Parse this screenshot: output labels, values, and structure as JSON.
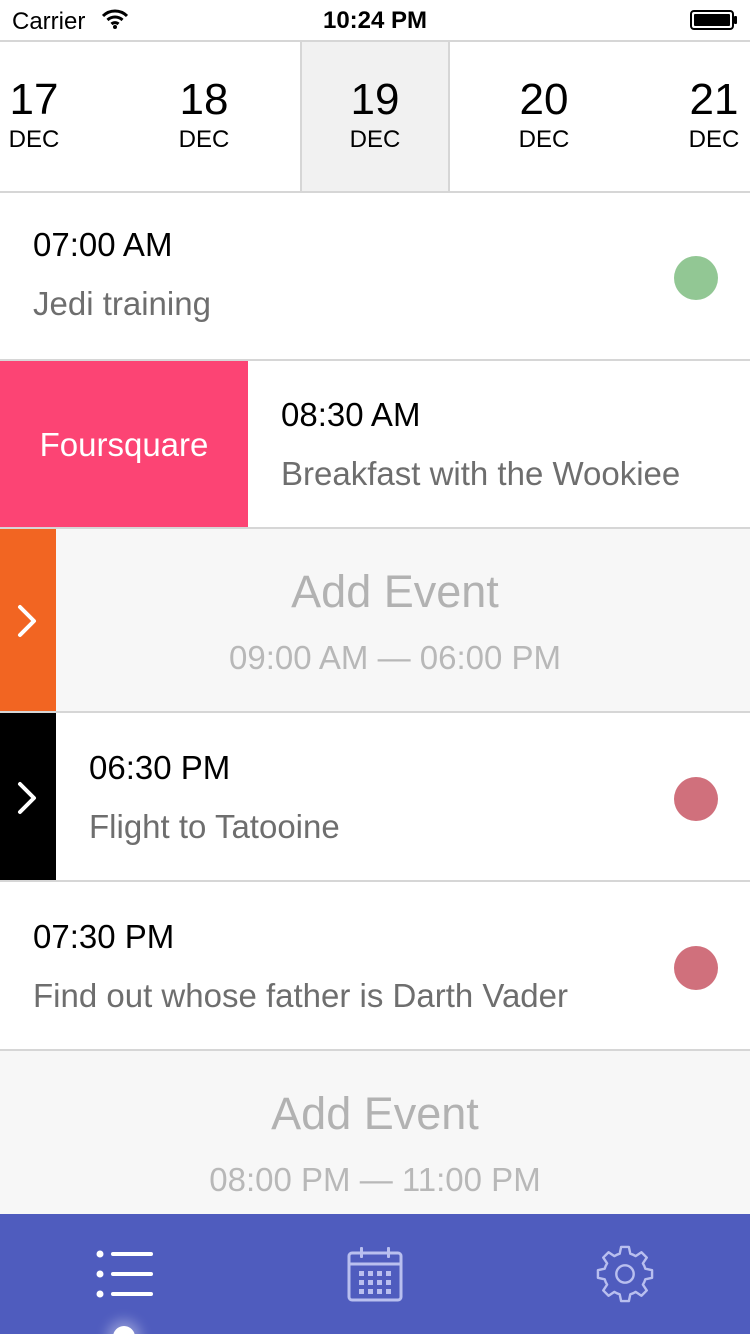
{
  "status_bar": {
    "carrier": "Carrier",
    "time": "10:24 PM",
    "wifi_icon": "wifi-icon",
    "battery_icon": "battery-icon"
  },
  "dates": [
    {
      "day": "17",
      "month": "DEC",
      "selected": false
    },
    {
      "day": "18",
      "month": "DEC",
      "selected": false
    },
    {
      "day": "19",
      "month": "DEC",
      "selected": true
    },
    {
      "day": "20",
      "month": "DEC",
      "selected": false
    },
    {
      "day": "21",
      "month": "DEC",
      "selected": false
    }
  ],
  "events": [
    {
      "time": "07:00 AM",
      "title": "Jedi training",
      "dot_color": "#92c794"
    },
    {
      "time": "08:30 AM",
      "title": "Breakfast with the Wookiee",
      "action_label": "Foursquare",
      "action_color": "#fc4474"
    },
    {
      "add_label": "Add Event",
      "range": "09:00 AM — 06:00 PM",
      "action_color": "#f26522",
      "action_icon": "chevron-right-icon"
    },
    {
      "time": "06:30 PM",
      "title": "Flight to Tatooine",
      "dot_color": "#d0707c",
      "action_color": "#000000",
      "action_icon": "chevron-right-icon"
    },
    {
      "time": "07:30 PM",
      "title": "Find out whose father is Darth Vader",
      "dot_color": "#d0707c"
    },
    {
      "add_label": "Add Event",
      "range": "08:00 PM — 11:00 PM"
    }
  ],
  "tab_bar": {
    "background": "#4f5cbe",
    "tabs": [
      {
        "icon": "list-icon",
        "active": true
      },
      {
        "icon": "calendar-icon",
        "active": false
      },
      {
        "icon": "gear-icon",
        "active": false
      }
    ]
  }
}
